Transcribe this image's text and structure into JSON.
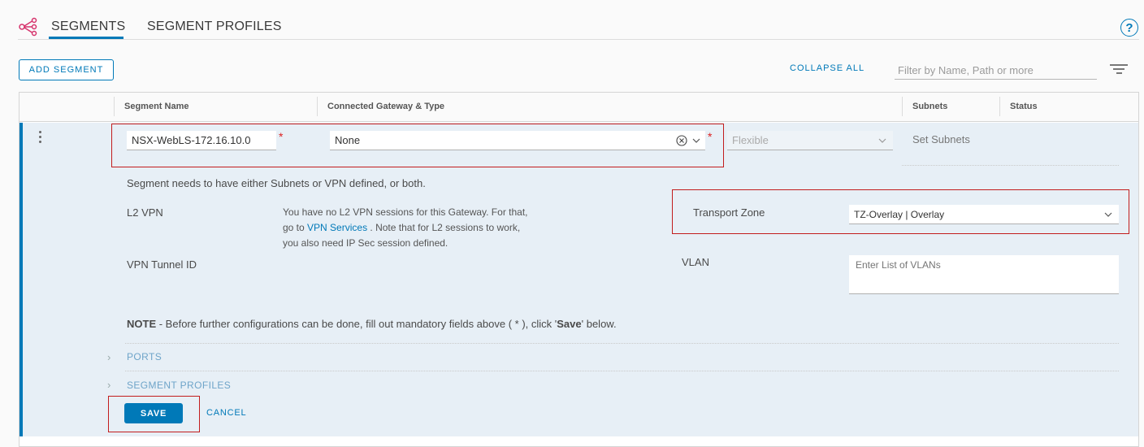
{
  "tabs": {
    "segments": "SEGMENTS",
    "segment_profiles": "SEGMENT PROFILES"
  },
  "help_label": "?",
  "toolbar": {
    "add_segment": "ADD SEGMENT",
    "collapse_all": "COLLAPSE ALL",
    "filter_placeholder": "Filter by Name, Path or more"
  },
  "table": {
    "headers": [
      "Segment Name",
      "Connected Gateway & Type",
      "Subnets",
      "Status"
    ]
  },
  "row": {
    "segment_name": "NSX-WebLS-172.16.10.0",
    "required_mark": "*",
    "gateway": "None",
    "gateway_type": "Flexible",
    "set_subnets": "Set Subnets",
    "subnet_note": "Segment needs to have either Subnets or VPN defined, or both.",
    "l2vpn_label": "L2 VPN",
    "l2vpn_text1": "You have no L2 VPN sessions for this Gateway. For that,",
    "l2vpn_text2a": "go to",
    "l2vpn_link": "VPN Services",
    "l2vpn_text2b": ". Note that for L2 sessions to work,",
    "l2vpn_text3": "you also need IP Sec session defined.",
    "vpn_tunnel_label": "VPN Tunnel ID",
    "transport_zone_label": "Transport Zone",
    "transport_zone_value": "TZ-Overlay | Overlay",
    "vlan_label": "VLAN",
    "vlan_placeholder": "Enter List of VLANs",
    "note_bold": "NOTE",
    "note_text": " - Before further configurations can be done, fill out mandatory fields above ( * ), click '",
    "note_save": "Save",
    "note_end": "' below.",
    "ports": "PORTS",
    "segment_profiles": "SEGMENT PROFILES",
    "save": "SAVE",
    "cancel": "CANCEL"
  },
  "colors": {
    "accent": "#0079b8",
    "highlight": "#c21d1d",
    "required": "#dd2222"
  }
}
